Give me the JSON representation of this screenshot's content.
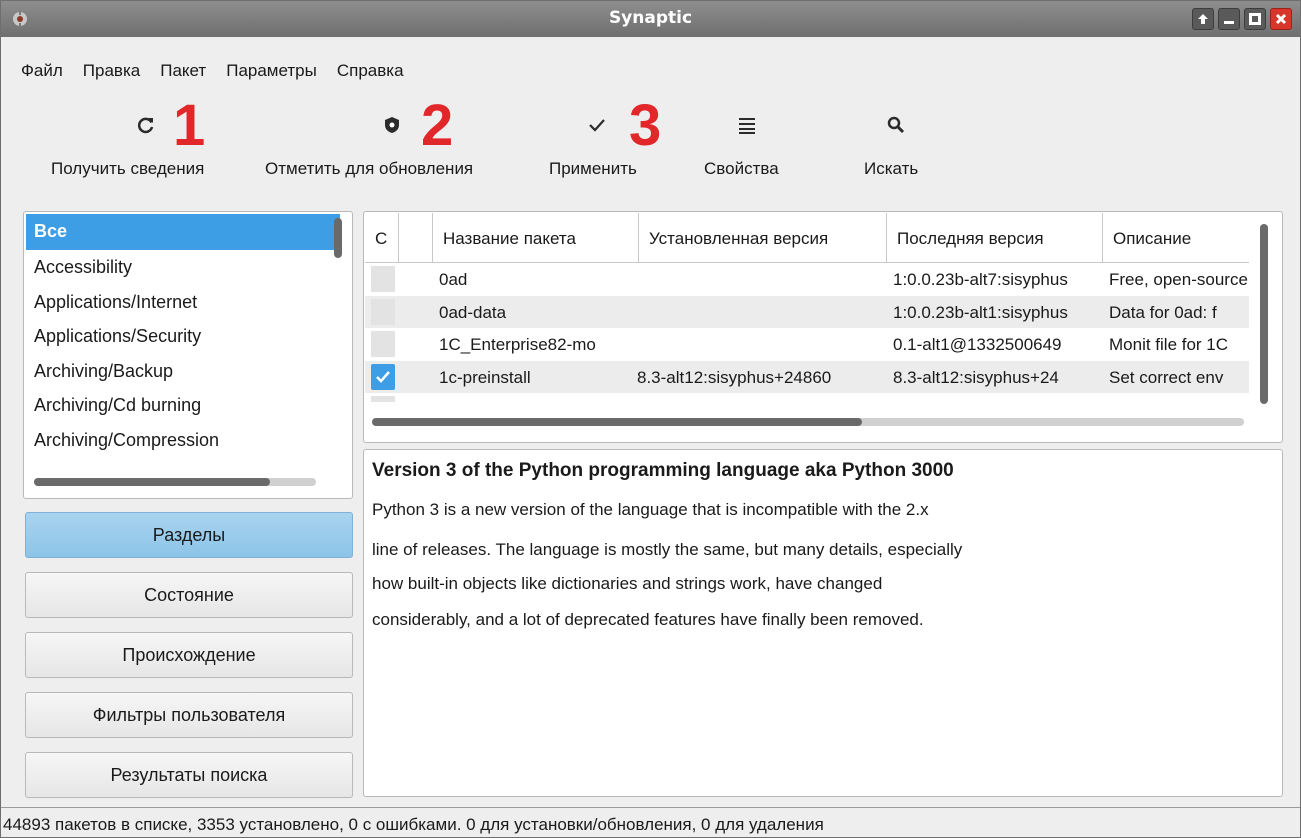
{
  "window": {
    "title": "Synaptic",
    "accent": "#3d9ee6",
    "step_color": "#e2272a"
  },
  "menu": [
    "Файл",
    "Правка",
    "Пакет",
    "Параметры",
    "Справка"
  ],
  "toolbar": [
    {
      "label": "Получить сведения",
      "icon": "refresh-icon",
      "step": "1"
    },
    {
      "label": "Отметить для обновления",
      "icon": "shield-icon",
      "step": "2"
    },
    {
      "label": "Применить",
      "icon": "checkmark-icon",
      "step": "3"
    },
    {
      "label": "Свойства",
      "icon": "list-icon"
    },
    {
      "label": "Искать",
      "icon": "search-icon"
    }
  ],
  "categories": {
    "items": [
      "Все",
      "Accessibility",
      "Applications/Internet",
      "Applications/Security",
      "Archiving/Backup",
      "Archiving/Cd burning",
      "Archiving/Compression"
    ],
    "selected": "Все"
  },
  "filters": [
    {
      "label": "Разделы",
      "active": true
    },
    {
      "label": "Состояние",
      "active": false
    },
    {
      "label": "Происхождение",
      "active": false
    },
    {
      "label": "Фильтры пользователя",
      "active": false
    },
    {
      "label": "Результаты поиска",
      "active": false
    }
  ],
  "packages": {
    "columns": [
      "С",
      "",
      "Название пакета",
      "Установленная версия",
      "Последняя версия",
      "Описание"
    ],
    "rows": [
      {
        "checked": false,
        "name": "0ad",
        "installed": "",
        "latest": "1:0.0.23b-alt7:sisyphus",
        "description": "Free, open-source"
      },
      {
        "checked": false,
        "name": "0ad-data",
        "installed": "",
        "latest": "1:0.0.23b-alt1:sisyphus",
        "description": "Data for 0ad: f"
      },
      {
        "checked": false,
        "name": "1C_Enterprise82-mo",
        "installed": "",
        "latest": "0.1-alt1@1332500649",
        "description": "Monit file for 1C"
      },
      {
        "checked": true,
        "name": "1c-preinstall",
        "installed": "8.3-alt12:sisyphus+24860",
        "latest": "8.3-alt12:sisyphus+24",
        "description": "Set correct env"
      }
    ]
  },
  "description": {
    "title": "Version 3 of the Python programming language aka Python 3000",
    "lines": [
      "Python 3 is a new version of the language that is incompatible with the 2.x",
      "line of releases. The language is mostly the same, but many details, especially",
      "how built-in objects like dictionaries and strings work, have changed",
      "considerably, and a lot of deprecated features have finally been removed."
    ]
  },
  "status": "44893 пакетов в списке, 3353 установлено, 0 с ошибками. 0 для установки/обновления, 0 для удаления"
}
